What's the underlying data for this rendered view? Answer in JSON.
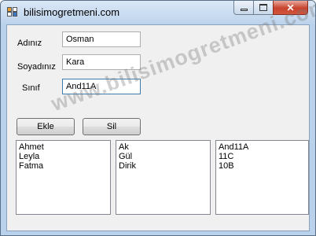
{
  "window": {
    "title": "bilisimogretmeni.com"
  },
  "controls": {
    "minimize": "▭",
    "maximize": "□",
    "close": "✕"
  },
  "form": {
    "adiniz_label": "Adınız",
    "adiniz_value": "Osman",
    "soyadiniz_label": "Soyadınız",
    "soyadiniz_value": "Kara",
    "sinif_label": "Sınıf",
    "sinif_value": "And11A"
  },
  "buttons": {
    "ekle": "Ekle",
    "sil": "Sil"
  },
  "lists": {
    "names": [
      "Ahmet",
      "Leyla",
      "Fatma"
    ],
    "surnames": [
      "Ak",
      "Gül",
      "Dirik"
    ],
    "classes": [
      "And11A",
      "11C",
      "10B"
    ]
  },
  "watermark": "www.bilisimogretmeni.com"
}
